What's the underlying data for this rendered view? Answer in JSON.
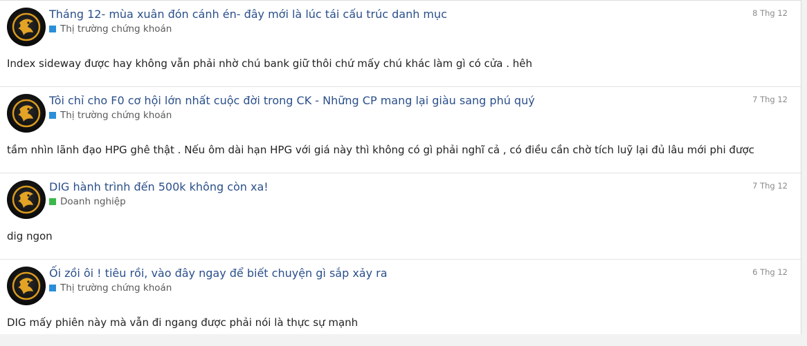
{
  "posts": [
    {
      "title": "Tháng 12- mùa xuân đón cánh én- đây mới là lúc tái cấu trúc danh mục",
      "forum": "Thị trường chứng khoán",
      "forum_color": "#2b8fd8",
      "date": "8 Thg 12",
      "snippet": "Index sideway được hay không vẫn phải nhờ chú bank giữ thôi chứ mấy chú khác làm gì có cửa . hêh"
    },
    {
      "title": "Tôi chỉ cho F0 cơ hội lớn nhất cuộc đời trong CK - Những CP mang lại giàu sang phú quý",
      "forum": "Thị trường chứng khoán",
      "forum_color": "#2b8fd8",
      "date": "7 Thg 12",
      "snippet": "tầm nhìn lãnh đạo HPG ghê thật . Nếu ôm dài hạn HPG với giá này thì không có gì phải nghĩ cả , có điều cần chờ tích luỹ lại đủ lâu mới phi được"
    },
    {
      "title": "DIG hành trình đến 500k không còn xa!",
      "forum": "Doanh nghiệp",
      "forum_color": "#3cb84a",
      "date": "7 Thg 12",
      "snippet": "dig ngon"
    },
    {
      "title": "Ối zồi ôi ! tiêu rồi, vào đây ngay để biết chuyện gì sắp xảy ra",
      "forum": "Thị trường chứng khoán",
      "forum_color": "#2b8fd8",
      "date": "6 Thg 12",
      "snippet": "DIG mấy phiên này mà vẫn đi ngang được phải nói là thực sự mạnh"
    }
  ]
}
